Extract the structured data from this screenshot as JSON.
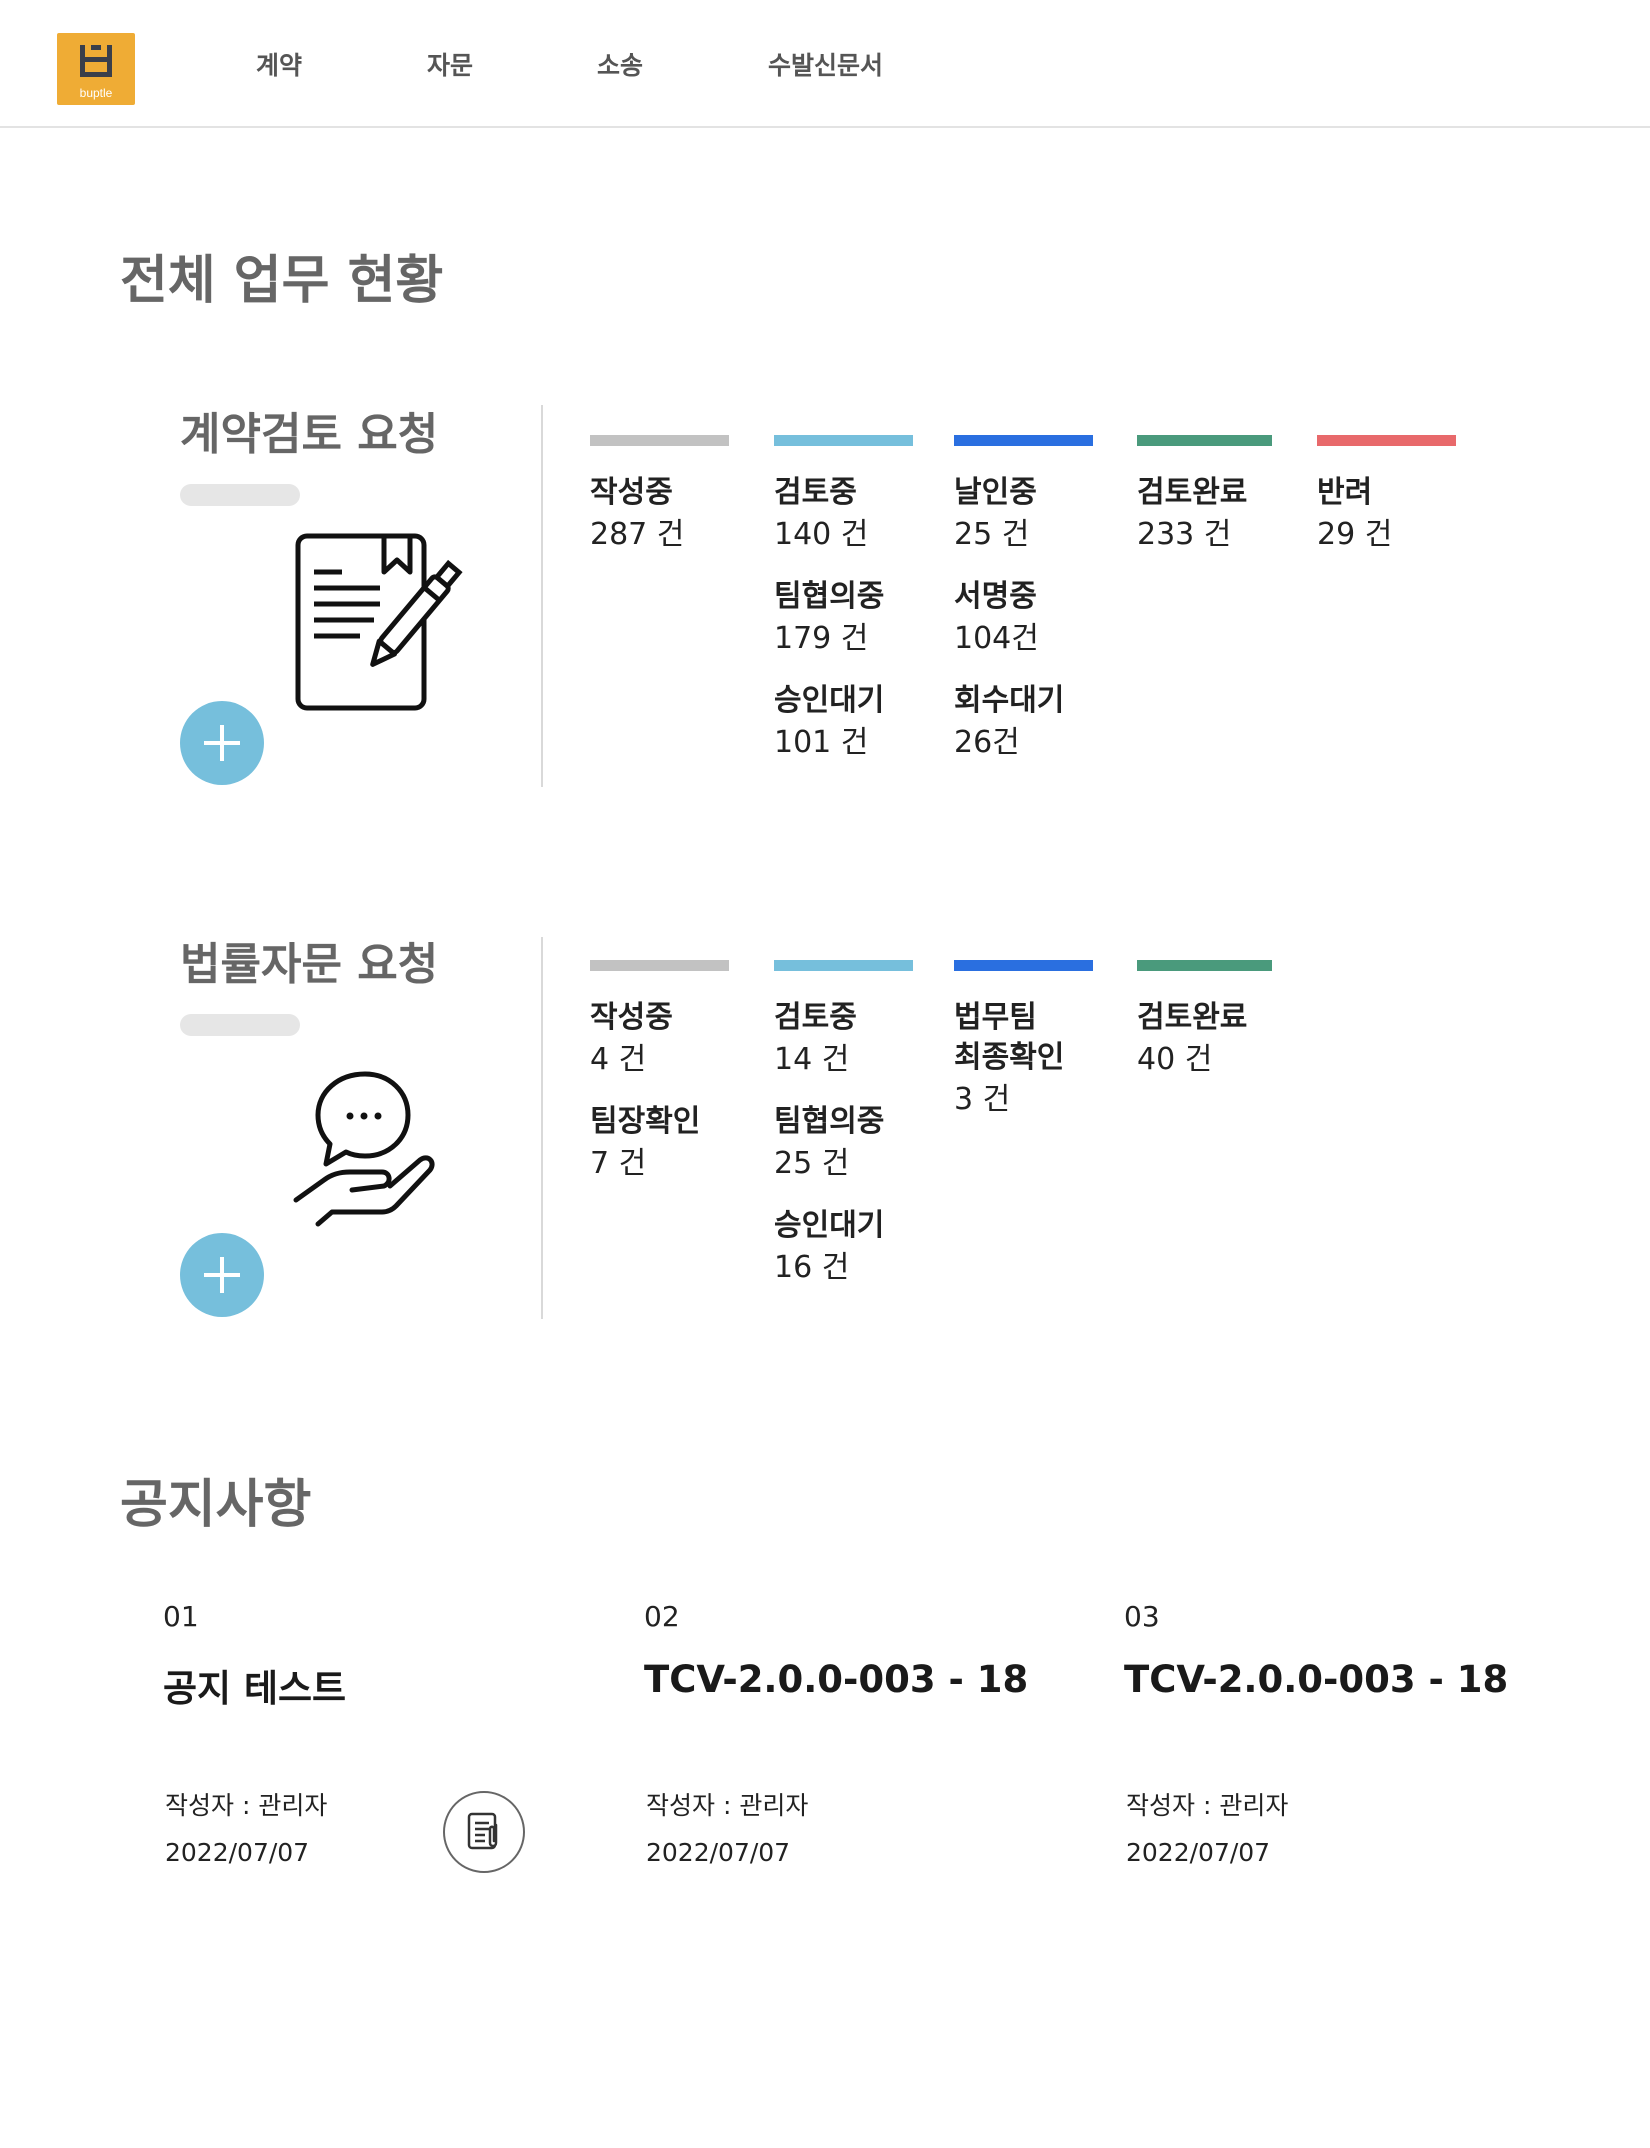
{
  "header": {
    "logo_text": "buptle",
    "nav": [
      "계약",
      "자문",
      "소송",
      "수발신문서"
    ]
  },
  "overview": {
    "title": "전체 업무 현황"
  },
  "colors": {
    "gray": "#c2c2c2",
    "light_blue": "#76bfdc",
    "blue": "#2a6fe0",
    "green": "#4a9a7c",
    "red": "#e8696b",
    "logo": "#efac35"
  },
  "contract_review": {
    "title": "계약검토 요청",
    "illustration_icon": "document-pen-icon",
    "columns": [
      {
        "color": "#c2c2c2",
        "items": [
          {
            "label": "작성중",
            "count": "287 건"
          }
        ]
      },
      {
        "color": "#76bfdc",
        "items": [
          {
            "label": "검토중",
            "count": "140 건"
          },
          {
            "label": "팀협의중",
            "count": "179 건"
          },
          {
            "label": "승인대기",
            "count": "101 건"
          }
        ]
      },
      {
        "color": "#2a6fe0",
        "items": [
          {
            "label": "날인중",
            "count": "25 건"
          },
          {
            "label": "서명중",
            "count": "104건"
          },
          {
            "label": "회수대기",
            "count": "26건"
          }
        ]
      },
      {
        "color": "#4a9a7c",
        "items": [
          {
            "label": "검토완료",
            "count": "233 건"
          }
        ]
      },
      {
        "color": "#e8696b",
        "items": [
          {
            "label": "반려",
            "count": "29 건"
          }
        ]
      }
    ]
  },
  "legal_advice": {
    "title": "법률자문 요청",
    "illustration_icon": "hand-chat-bubble-icon",
    "columns": [
      {
        "color": "#c2c2c2",
        "items": [
          {
            "label": "작성중",
            "count": "4 건"
          },
          {
            "label": "팀장확인",
            "count": "7 건"
          }
        ]
      },
      {
        "color": "#76bfdc",
        "items": [
          {
            "label": "검토중",
            "count": "14 건"
          },
          {
            "label": "팀협의중",
            "count": "25 건"
          },
          {
            "label": "승인대기",
            "count": "16 건"
          }
        ]
      },
      {
        "color": "#2a6fe0",
        "items": [
          {
            "label": "법무팀",
            "label2": "최종확인",
            "count": "3 건"
          }
        ]
      },
      {
        "color": "#4a9a7c",
        "items": [
          {
            "label": "검토완료",
            "count": "40 건"
          }
        ]
      }
    ]
  },
  "notices": {
    "title": "공지사항",
    "items": [
      {
        "num": "01",
        "title": "공지 테스트",
        "author": "작성자 : 관리자",
        "date": "2022/07/07",
        "attachment_icon": "document-attachment-icon"
      },
      {
        "num": "02",
        "title": "TCV-2.0.0-003 - 18",
        "author": "작성자 : 관리자",
        "date": "2022/07/07"
      },
      {
        "num": "03",
        "title": "TCV-2.0.0-003 - 18",
        "author": "작성자 : 관리자",
        "date": "2022/07/07"
      }
    ]
  }
}
